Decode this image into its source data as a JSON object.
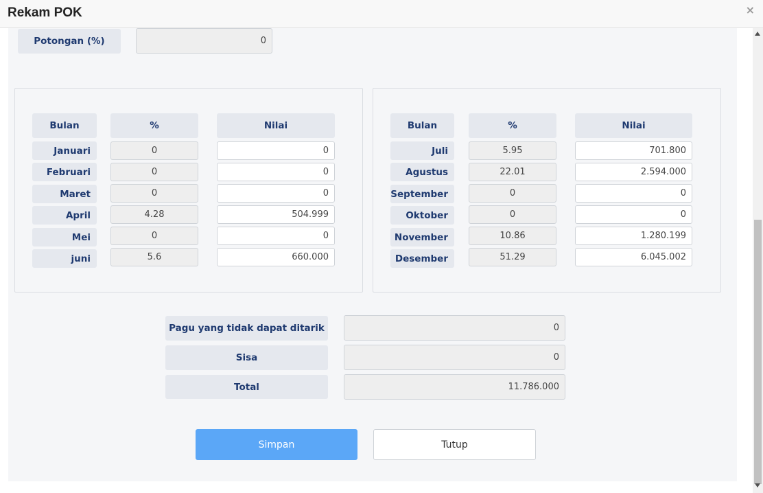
{
  "dialog": {
    "title": "Rekam POK",
    "close_symbol": "×"
  },
  "potongan": {
    "label": "Potongan (%)",
    "value": "0"
  },
  "table_headers": {
    "bulan": "Bulan",
    "persen": "%",
    "nilai": "Nilai"
  },
  "left_months": [
    {
      "bulan": "Januari",
      "persen": "0",
      "nilai": "0"
    },
    {
      "bulan": "Februari",
      "persen": "0",
      "nilai": "0"
    },
    {
      "bulan": "Maret",
      "persen": "0",
      "nilai": "0"
    },
    {
      "bulan": "April",
      "persen": "4.28",
      "nilai": "504.999"
    },
    {
      "bulan": "Mei",
      "persen": "0",
      "nilai": "0"
    },
    {
      "bulan": "juni",
      "persen": "5.6",
      "nilai": "660.000"
    }
  ],
  "right_months": [
    {
      "bulan": "Juli",
      "persen": "5.95",
      "nilai": "701.800"
    },
    {
      "bulan": "Agustus",
      "persen": "22.01",
      "nilai": "2.594.000"
    },
    {
      "bulan": "September",
      "persen": "0",
      "nilai": "0"
    },
    {
      "bulan": "Oktober",
      "persen": "0",
      "nilai": "0"
    },
    {
      "bulan": "November",
      "persen": "10.86",
      "nilai": "1.280.199"
    },
    {
      "bulan": "Desember",
      "persen": "51.29",
      "nilai": "6.045.002"
    }
  ],
  "summary": {
    "pagu_label": "Pagu yang tidak dapat ditarik",
    "pagu_value": "0",
    "sisa_label": "Sisa",
    "sisa_value": "0",
    "total_label": "Total",
    "total_value": "11.786.000"
  },
  "buttons": {
    "simpan": "Simpan",
    "tutup": "Tutup"
  }
}
